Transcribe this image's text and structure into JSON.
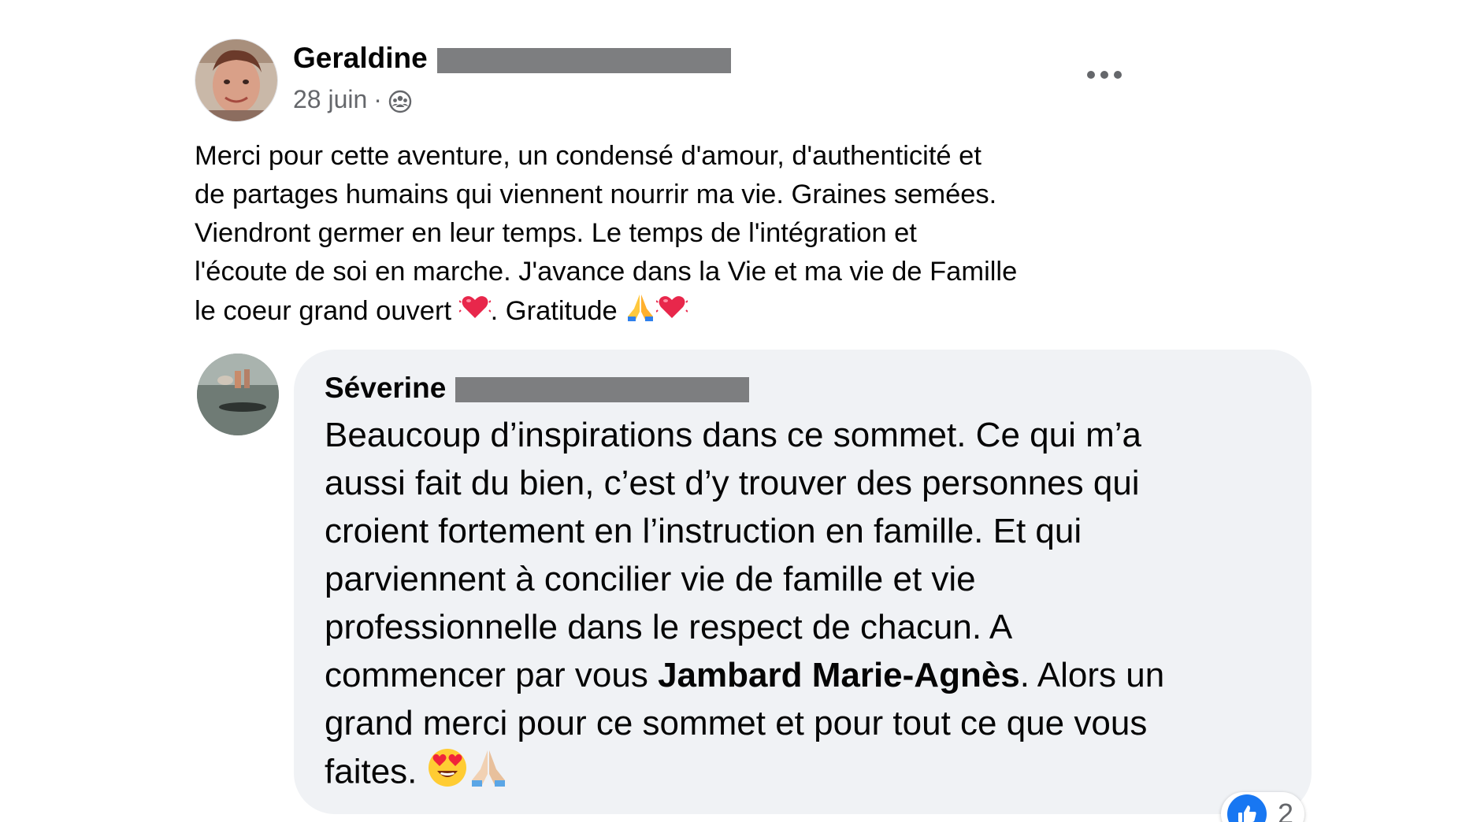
{
  "post": {
    "author_name": "Geraldine",
    "date": "28 juin",
    "separator": "·",
    "audience_icon": "group-audience-icon",
    "more_label": "•••",
    "text_lines": [
      "Merci pour cette aventure, un condensé d'amour, d'authenticité et",
      "de partages humains qui viennent nourrir ma vie. Graines semées.",
      "Viendront germer en leur temps. Le temps de l'intégration et",
      "l'écoute de soi en marche. J'avance dans la Vie et ma vie de Famille"
    ],
    "last_line_a": "le coeur grand ouvert ",
    "last_line_b": ". Gratitude ",
    "emojis": [
      "beating-heart-emoji",
      "folded-hands-emoji",
      "beating-heart-emoji"
    ]
  },
  "comment": {
    "author_name": "Séverine",
    "text_lines": [
      "Beaucoup d’inspirations dans ce sommet. Ce qui m’a",
      "aussi fait du bien, c’est d’y trouver des personnes qui",
      "croient fortement en l’instruction en famille. Et qui",
      "parviennent à concilier vie de famille et vie",
      "professionnelle dans le respect de chacun. A"
    ],
    "line6_a": "commencer par vous ",
    "mention": "Jambard Marie-Agnès",
    "line6_b": ". Alors un",
    "line7": "grand merci pour ce sommet et pour tout ce que vous",
    "line8": "faites. ",
    "emojis": [
      "heart-eyes-emoji",
      "folded-hands-emoji"
    ],
    "reaction_count": "2",
    "reaction_icon": "like-icon",
    "colors": {
      "bubble": "#f0f2f5",
      "like_blue": "#1877f2",
      "meta_gray": "#65676b"
    }
  }
}
